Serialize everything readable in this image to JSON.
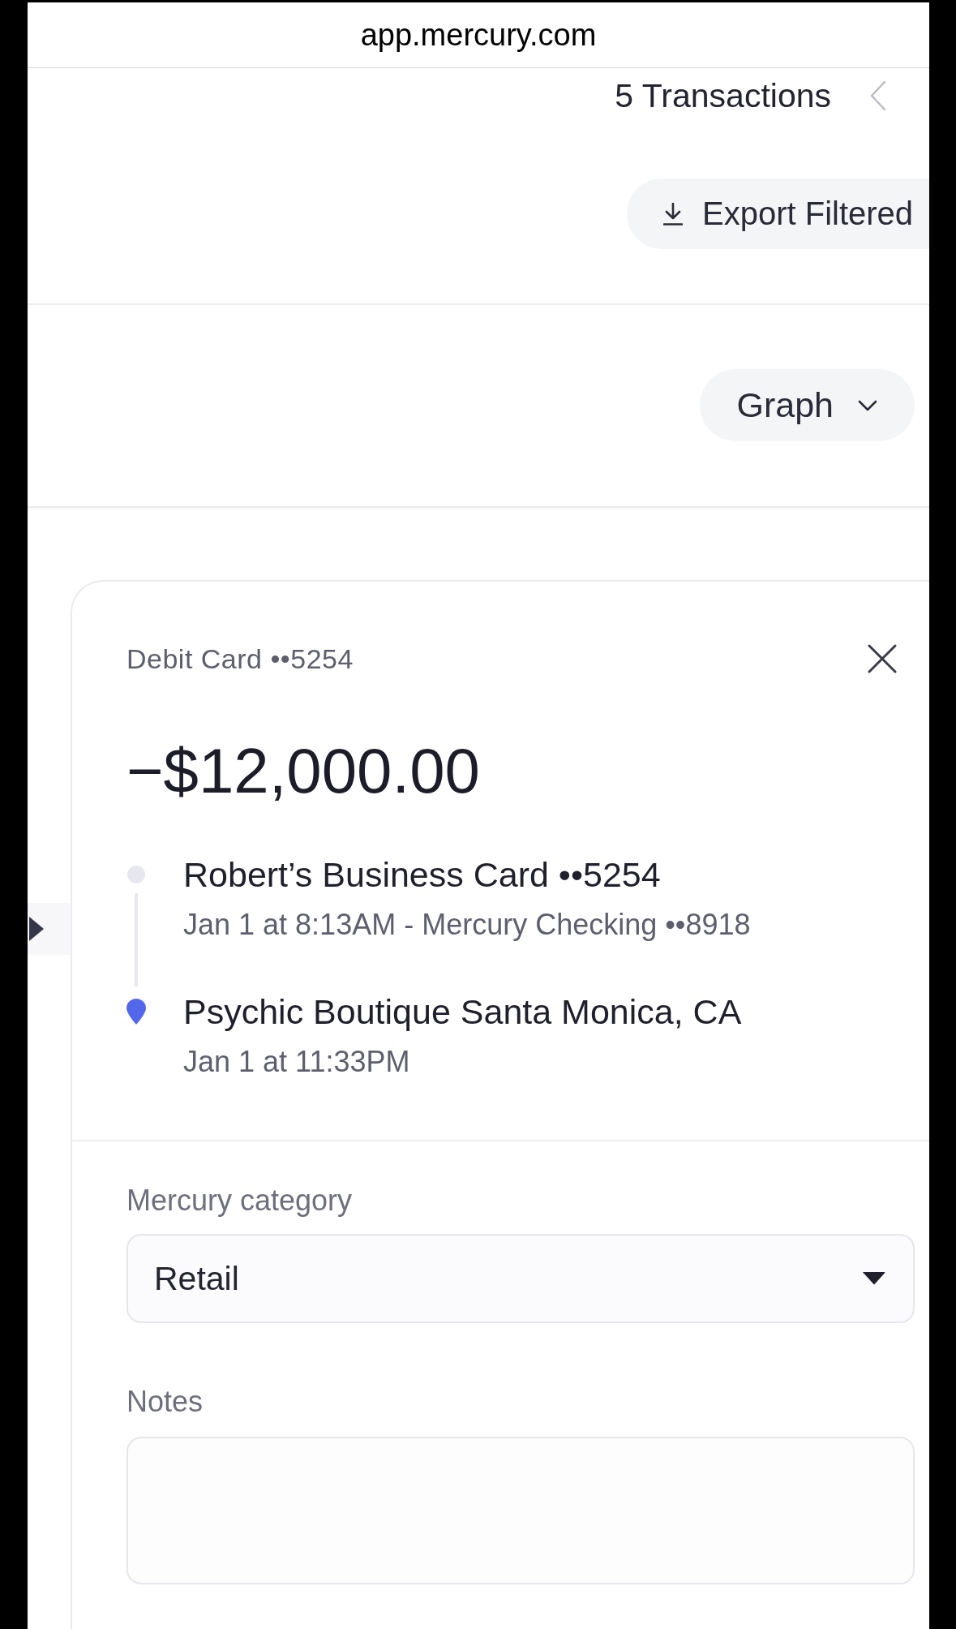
{
  "browser": {
    "url": "app.mercury.com"
  },
  "header": {
    "count_label": "5 Transactions",
    "export_button": "Export Filtered"
  },
  "view_menu": {
    "label": "Graph"
  },
  "transaction": {
    "source": "Debit Card ••5254",
    "amount": "−$12,000.00",
    "timeline": [
      {
        "kind": "origin",
        "title": "Robert’s Business Card ••5254",
        "detail": "Jan 1 at 8:13AM - Mercury Checking ••8918"
      },
      {
        "kind": "destination",
        "title": "Psychic Boutique Santa Monica, CA",
        "detail": "Jan 1 at 11:33PM"
      }
    ],
    "category": {
      "label": "Mercury category",
      "value": "Retail"
    },
    "notes": {
      "label": "Notes"
    }
  }
}
